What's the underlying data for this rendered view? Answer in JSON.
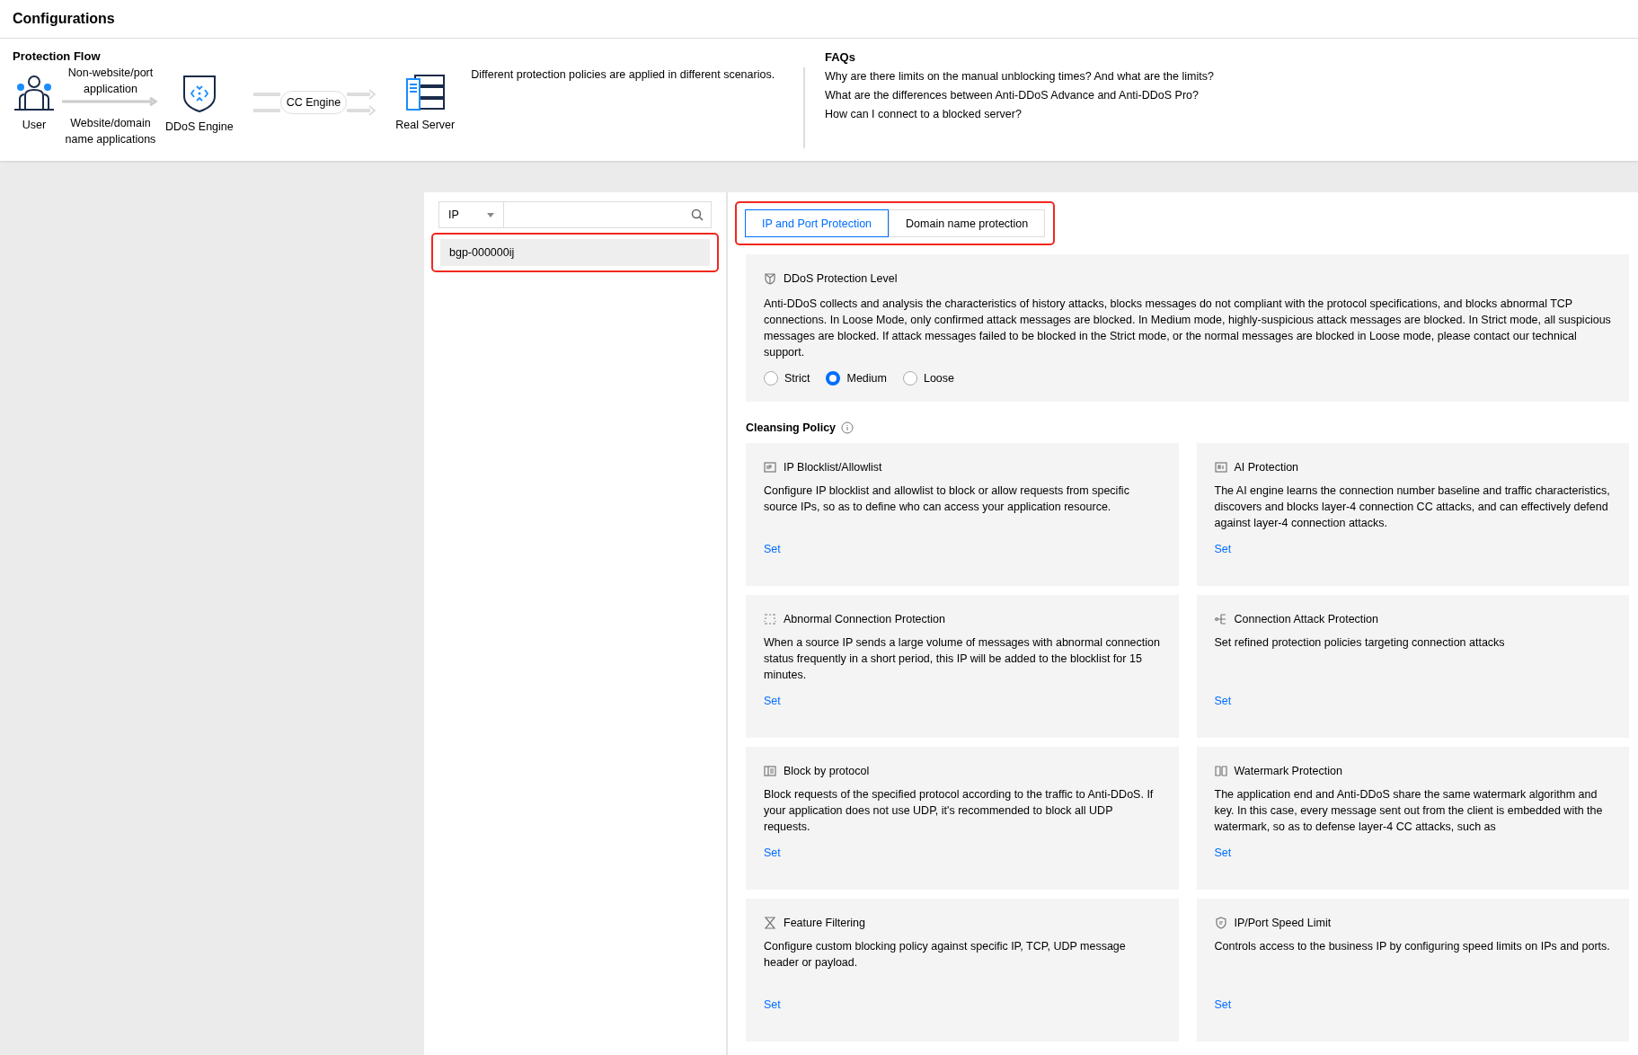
{
  "header": {
    "title": "Configurations"
  },
  "flow": {
    "title": "Protection Flow",
    "user": "User",
    "path_top": "Non-website/port application",
    "path_bottom": "Website/domain name applications",
    "engine": "DDoS Engine",
    "cc": "CC Engine",
    "server": "Real Server",
    "note": "Different protection policies are applied in different scenarios."
  },
  "faqs": {
    "title": "FAQs",
    "items": [
      "Why are there limits on the manual unblocking times? And what are the limits?",
      "What are the differences between Anti-DDoS Advance and Anti-DDoS Pro?",
      "How can I connect to a blocked server?"
    ]
  },
  "sidebar": {
    "filter": "IP",
    "items": [
      {
        "label": "bgp-000000ij",
        "selected": true,
        "highlighted": true
      }
    ]
  },
  "tabs": {
    "highlighted": true,
    "items": [
      {
        "label": "IP and Port Protection",
        "selected": true
      },
      {
        "label": "Domain name protection",
        "selected": false
      }
    ]
  },
  "level": {
    "title": "DDoS Protection Level",
    "description": "Anti-DDoS collects and analysis the characteristics of history attacks, blocks messages do not compliant with the protocol specifications, and blocks abnormal TCP connections. In Loose Mode, only confirmed attack messages are blocked. In Medium mode, highly-suspicious attack messages are blocked. In Strict mode, all suspicious messages are blocked. If attack messages failed to be blocked in the Strict mode, or the normal messages are blocked in Loose mode, please contact our technical support.",
    "options": [
      {
        "label": "Strict",
        "selected": false
      },
      {
        "label": "Medium",
        "selected": true
      },
      {
        "label": "Loose",
        "selected": false
      }
    ]
  },
  "policy": {
    "title": "Cleansing Policy",
    "cards": [
      {
        "kind": "ip",
        "title": "IP Blocklist/Allowlist",
        "description": "Configure IP blocklist and allowlist to block or allow requests from specific source IPs, so as to define who can access your application resource.",
        "action": "Set"
      },
      {
        "kind": "ai",
        "title": "AI Protection",
        "description": "The AI engine learns the connection number baseline and traffic characteristics, discovers and blocks layer-4 connection CC attacks, and can effectively defend against layer-4 connection attacks.",
        "action": "Set"
      },
      {
        "kind": "abnormal",
        "title": "Abnormal Connection Protection",
        "description": "When a source IP sends a large volume of messages with abnormal connection status frequently in a short period, this IP will be added to the blocklist for 15 minutes.",
        "action": "Set"
      },
      {
        "kind": "connection",
        "title": "Connection Attack Protection",
        "description": "Set refined protection policies targeting connection attacks",
        "action": "Set"
      },
      {
        "kind": "protocol",
        "title": "Block by protocol",
        "description": "Block requests of the specified protocol according to the traffic to Anti-DDoS. If your application does not use UDP, it's recommended to block all UDP requests.",
        "action": "Set"
      },
      {
        "kind": "watermark",
        "title": "Watermark Protection",
        "description": "The application end and Anti-DDoS share the same watermark algorithm and key. In this case, every message sent out from the client is embedded with the watermark, so as to defense layer-4 CC attacks, such as",
        "action": "Set"
      },
      {
        "kind": "filter",
        "title": "Feature Filtering",
        "description": "Configure custom blocking policy against specific IP, TCP, UDP message header or payload.",
        "action": "Set"
      },
      {
        "kind": "speed",
        "title": "IP/Port Speed Limit",
        "description": "Controls access to the business IP by configuring speed limits on IPs and ports.",
        "action": "Set"
      }
    ]
  }
}
